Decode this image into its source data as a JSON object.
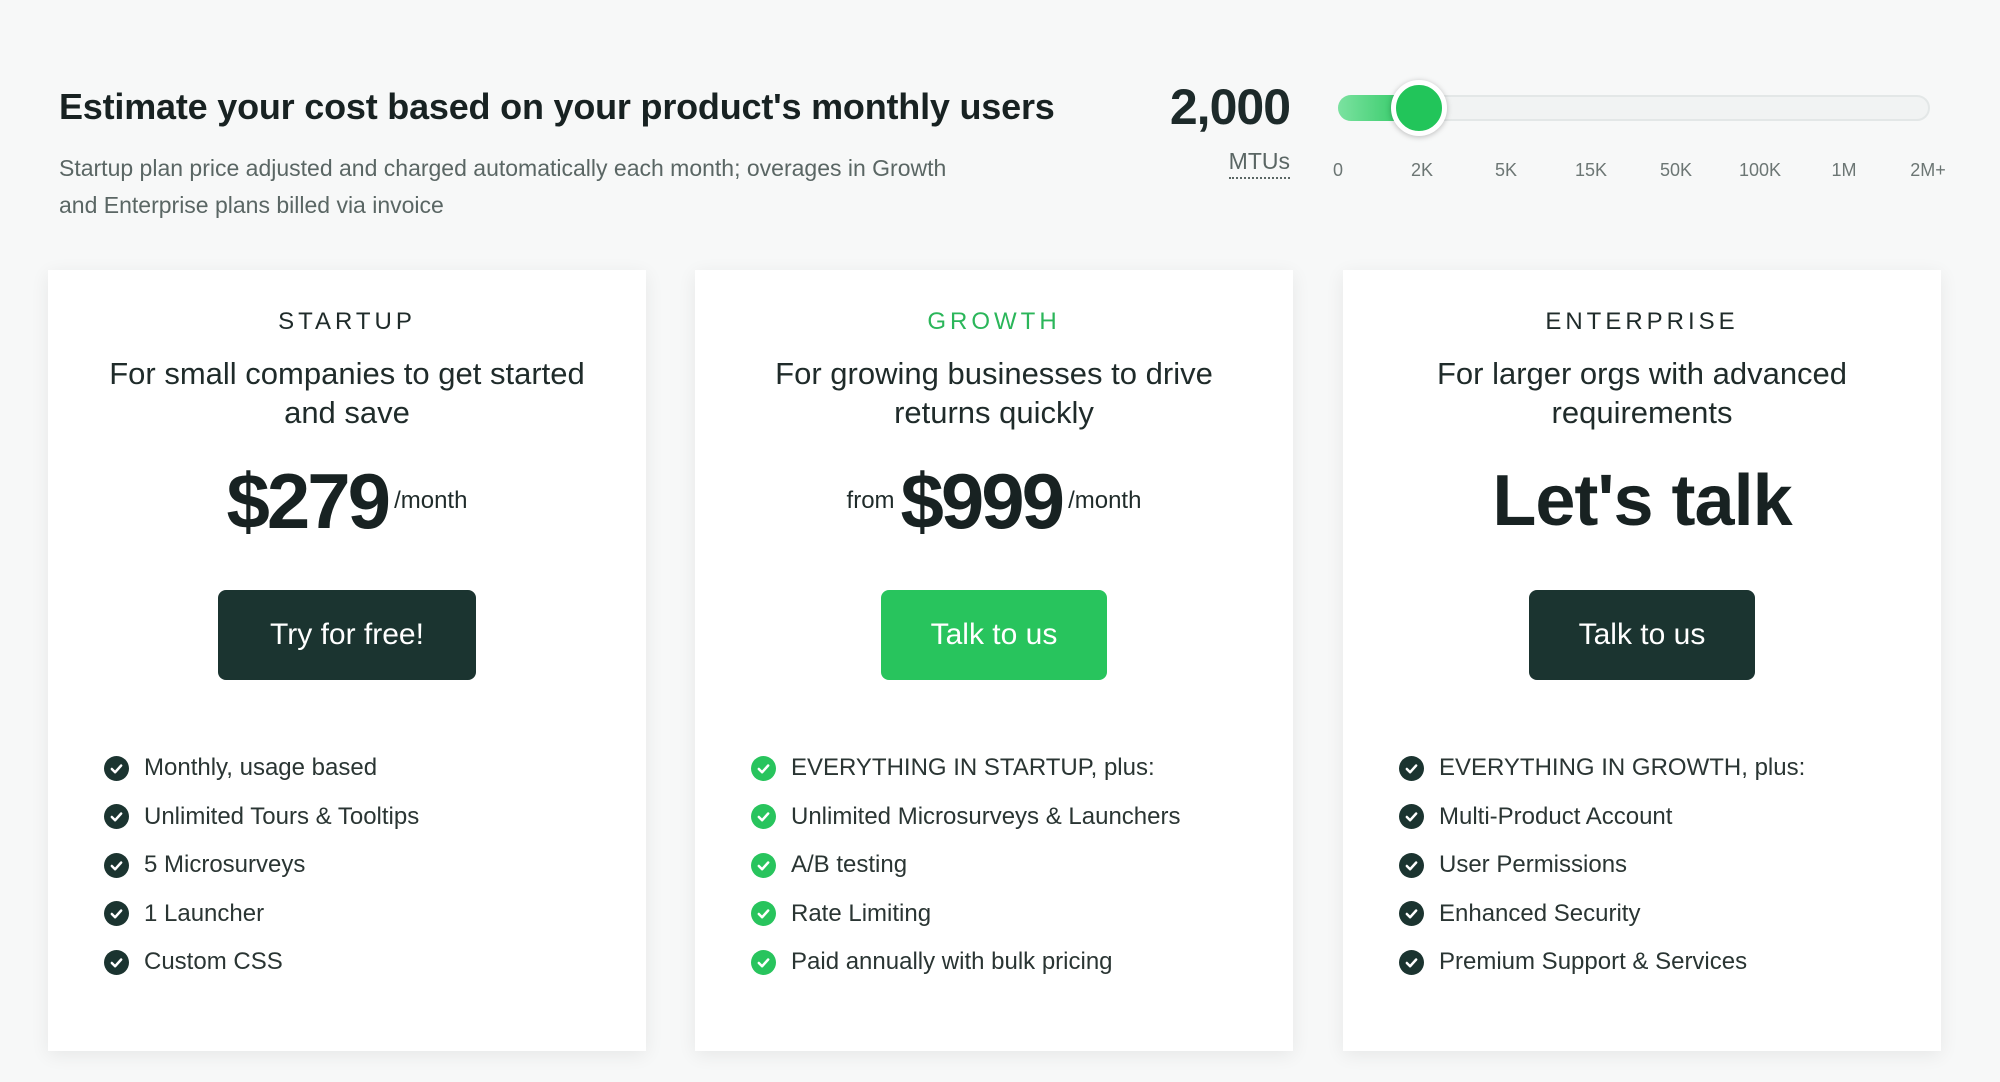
{
  "estimator": {
    "title": "Estimate your cost based on your product's monthly users",
    "subtitle": "Startup plan price adjusted and charged automatically each month; overages in Growth and Enterprise plans billed via invoice",
    "mtu_count": "2,000",
    "mtu_unit": "MTUs",
    "slider": {
      "ticks": [
        "0",
        "2K",
        "5K",
        "15K",
        "50K",
        "100K",
        "1M",
        "2M+"
      ],
      "selected_tick": "2K",
      "fill_fraction": 0.11,
      "fill_color": "#25c55c"
    }
  },
  "plans": [
    {
      "name": "STARTUP",
      "description": "For small companies to get started and save",
      "price_prefix": "",
      "price": "$279",
      "price_suffix": "/month",
      "cta": "Try for free!",
      "features": [
        "Monthly, usage based",
        "Unlimited Tours & Tooltips",
        "5 Microsurveys",
        "1 Launcher",
        "Custom CSS"
      ]
    },
    {
      "name": "GROWTH",
      "description": "For growing businesses to drive returns quickly",
      "price_prefix": "from",
      "price": "$999",
      "price_suffix": "/month",
      "cta": "Talk to us",
      "features": [
        "EVERYTHING IN STARTUP, plus:",
        "Unlimited Microsurveys & Launchers",
        "A/B testing",
        "Rate Limiting",
        "Paid annually with bulk pricing"
      ]
    },
    {
      "name": "ENTERPRISE",
      "description": "For larger orgs with advanced requirements",
      "price": "Let's talk",
      "cta": "Talk to us",
      "features": [
        "EVERYTHING IN GROWTH, plus:",
        "Multi-Product Account",
        "User Permissions",
        "Enhanced Security",
        "Premium Support & Services"
      ]
    }
  ],
  "colors": {
    "accent_green": "#28c45d",
    "dark_button": "#1b3430",
    "background": "#f7f8f8"
  },
  "icons": {
    "feature_check": "check-circle-icon"
  }
}
